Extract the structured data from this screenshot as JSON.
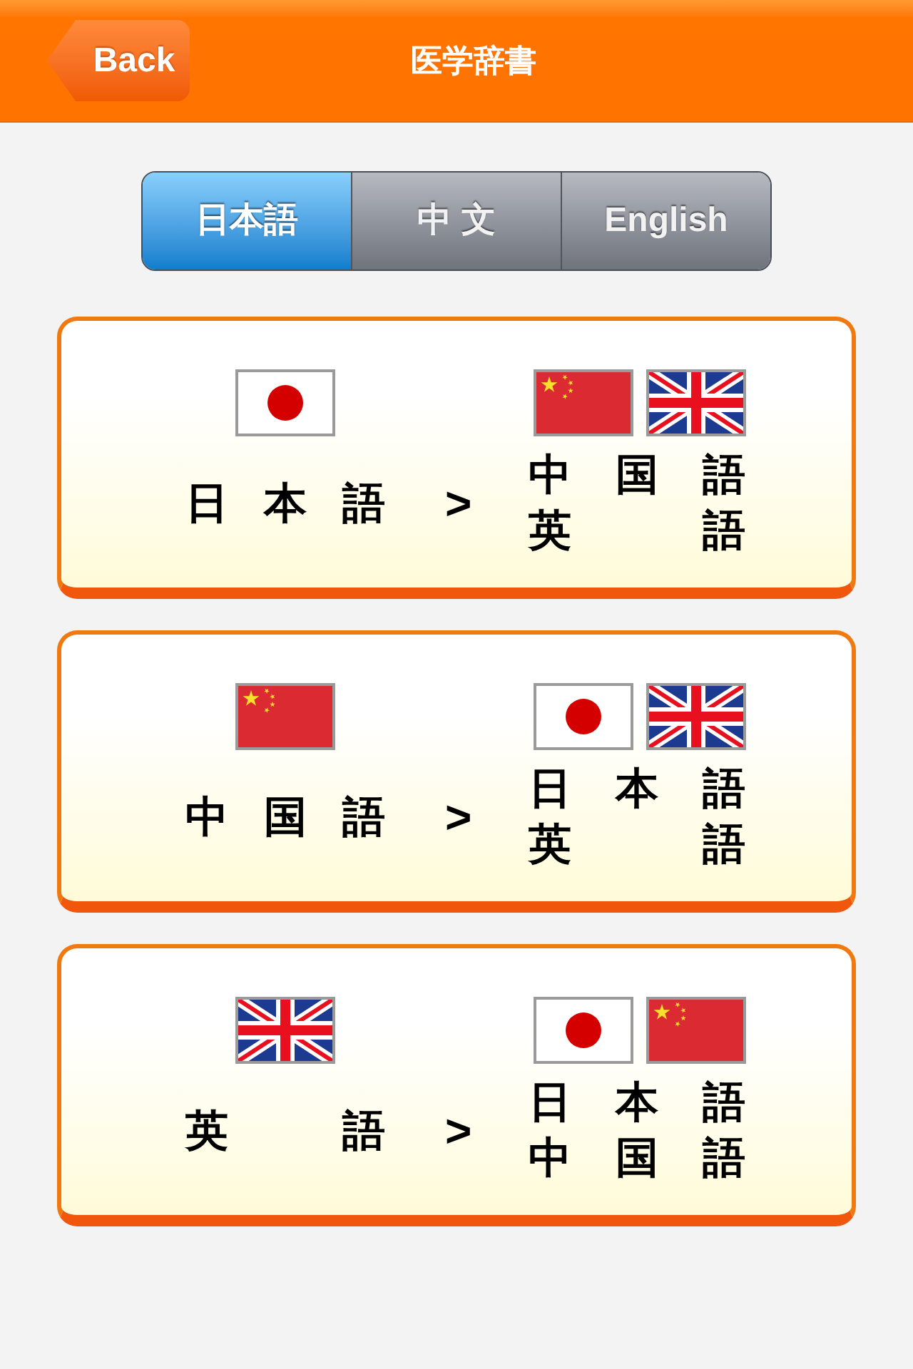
{
  "nav": {
    "back": "Back",
    "title": "医学辞書"
  },
  "tabs": [
    {
      "label": "日本語",
      "selected": true
    },
    {
      "label": "中 文",
      "selected": false
    },
    {
      "label": "English",
      "selected": false
    }
  ],
  "cards": [
    {
      "source": {
        "kind": "japan",
        "language": "日本語"
      },
      "arrow": ">",
      "targets": [
        {
          "kind": "china",
          "language": "中国語"
        },
        {
          "kind": "uk",
          "language": "英語"
        }
      ]
    },
    {
      "source": {
        "kind": "china",
        "language": "中国語"
      },
      "arrow": ">",
      "targets": [
        {
          "kind": "japan",
          "language": "日本語"
        },
        {
          "kind": "uk",
          "language": "英語"
        }
      ]
    },
    {
      "source": {
        "kind": "uk",
        "language": "英語"
      },
      "arrow": ">",
      "targets": [
        {
          "kind": "japan",
          "language": "日本語"
        },
        {
          "kind": "china",
          "language": "中国語"
        }
      ]
    }
  ]
}
